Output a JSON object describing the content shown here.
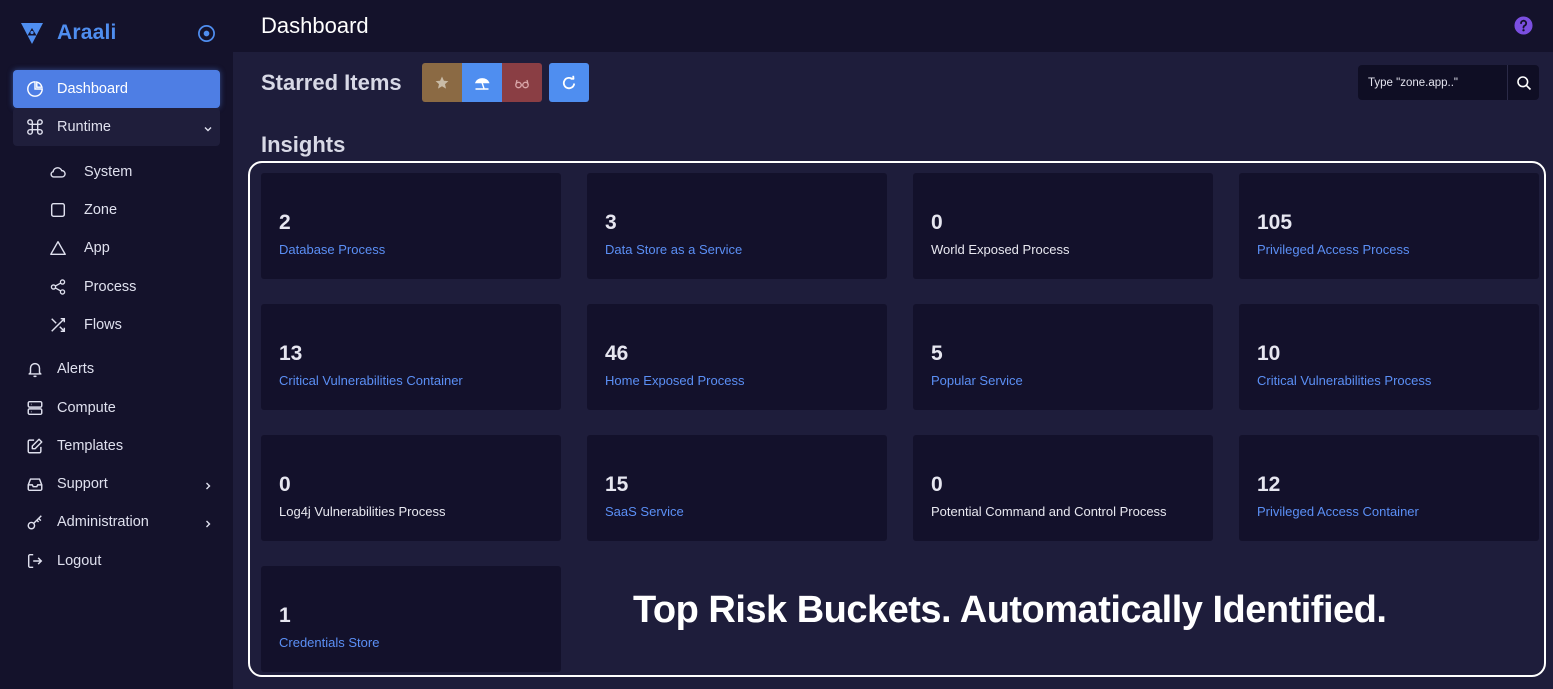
{
  "brand": {
    "name": "Araali"
  },
  "sidebar": {
    "items": [
      {
        "label": "Dashboard",
        "icon": "pie-chart-icon"
      },
      {
        "label": "Runtime",
        "icon": "command-icon"
      },
      {
        "label": "System",
        "icon": "cloud-icon"
      },
      {
        "label": "Zone",
        "icon": "square-icon"
      },
      {
        "label": "App",
        "icon": "triangle-icon"
      },
      {
        "label": "Process",
        "icon": "share-icon"
      },
      {
        "label": "Flows",
        "icon": "shuffle-icon"
      },
      {
        "label": "Alerts",
        "icon": "bell-icon"
      },
      {
        "label": "Compute",
        "icon": "server-icon"
      },
      {
        "label": "Templates",
        "icon": "edit-icon"
      },
      {
        "label": "Support",
        "icon": "inbox-icon"
      },
      {
        "label": "Administration",
        "icon": "key-icon"
      },
      {
        "label": "Logout",
        "icon": "logout-icon"
      }
    ]
  },
  "header": {
    "title": "Dashboard"
  },
  "starred": {
    "title": "Starred Items"
  },
  "search": {
    "placeholder": "Type \"zone.app..\""
  },
  "insights": {
    "title": "Insights",
    "cards": [
      {
        "value": "2",
        "label": "Database Process",
        "link": true
      },
      {
        "value": "3",
        "label": "Data Store as a Service",
        "link": true
      },
      {
        "value": "0",
        "label": "World Exposed Process",
        "link": false
      },
      {
        "value": "105",
        "label": "Privileged Access Process",
        "link": true
      },
      {
        "value": "13",
        "label": "Critical Vulnerabilities Container",
        "link": true
      },
      {
        "value": "46",
        "label": "Home Exposed Process",
        "link": true
      },
      {
        "value": "5",
        "label": "Popular Service",
        "link": true
      },
      {
        "value": "10",
        "label": "Critical Vulnerabilities Process",
        "link": true
      },
      {
        "value": "0",
        "label": "Log4j Vulnerabilities Process",
        "link": false
      },
      {
        "value": "15",
        "label": "SaaS Service",
        "link": true
      },
      {
        "value": "0",
        "label": "Potential Command and Control Process",
        "link": false
      },
      {
        "value": "12",
        "label": "Privileged Access Container",
        "link": true
      },
      {
        "value": "1",
        "label": "Credentials Store",
        "link": true
      }
    ]
  },
  "banner": {
    "text": "Top Risk Buckets. Automatically Identified."
  },
  "colors": {
    "accent": "#4e7ee4",
    "link": "#5b8ff5",
    "sidebar_bg": "#14122b",
    "card_bg": "#13112b",
    "page_bg": "#1e1d3b",
    "star_button": "#8b6a44",
    "glasses_button": "#8a3e44",
    "help": "#7b4fe0"
  }
}
